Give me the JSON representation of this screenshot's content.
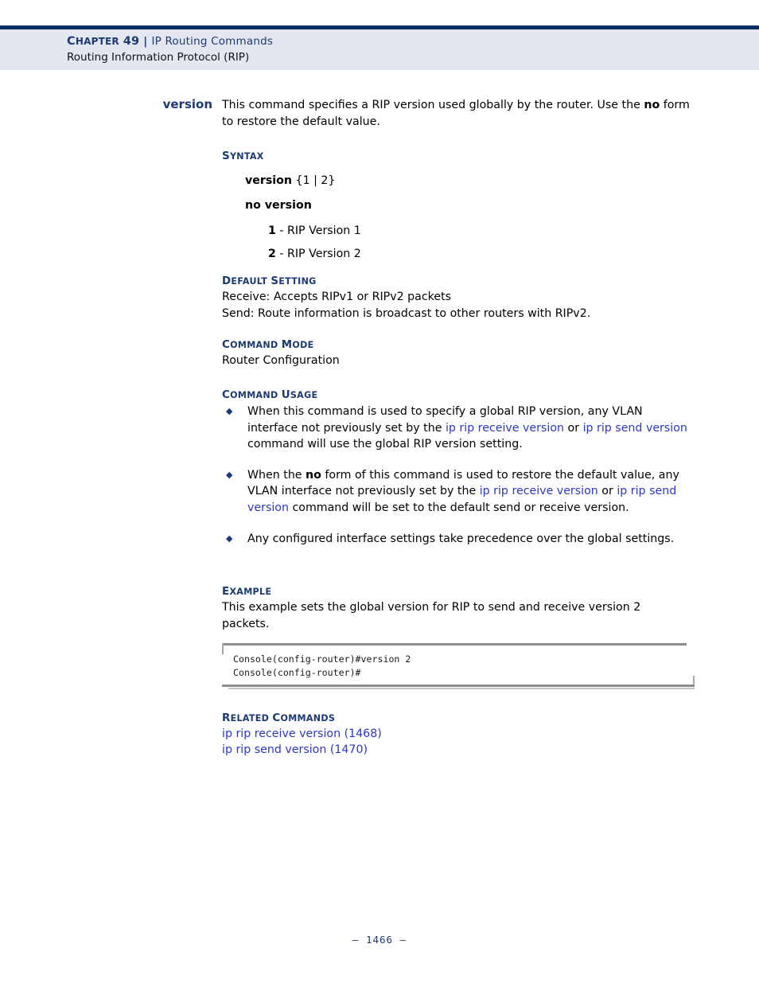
{
  "header": {
    "chapter_label_cap": "C",
    "chapter_label_rest": "HAPTER",
    "chapter_number": "49",
    "separator": "|",
    "topic": "IP Routing Commands",
    "subtitle": "Routing Information Protocol (RIP)"
  },
  "command": {
    "name": "version",
    "intro_part1": "This command specifies a RIP version used globally by the router. Use the ",
    "intro_bold": "no",
    "intro_part2": " form to restore the default value."
  },
  "sections": {
    "syntax": {
      "cap": "S",
      "rest": "YNTAX"
    },
    "default_setting": {
      "cap": "D",
      "rest": "EFAULT ",
      "cap2": "S",
      "rest2": "ETTING"
    },
    "command_mode": {
      "cap": "C",
      "rest": "OMMAND ",
      "cap2": "M",
      "rest2": "ODE"
    },
    "command_usage": {
      "cap": "C",
      "rest": "OMMAND ",
      "cap2": "U",
      "rest2": "SAGE"
    },
    "example": {
      "cap": "E",
      "rest": "XAMPLE"
    },
    "related_commands": {
      "cap": "R",
      "rest": "ELATED ",
      "cap2": "C",
      "rest2": "OMMANDS"
    }
  },
  "syntax": {
    "command_name": "version",
    "braces": " {1 | 2}",
    "brace_open": "{",
    "brace_arg1": "1",
    "brace_pipe": "|",
    "brace_arg2": "2",
    "brace_close": "}",
    "no_form": "no version",
    "args": [
      {
        "key": "1",
        "desc": " - RIP Version 1"
      },
      {
        "key": "2",
        "desc": " - RIP Version 2"
      }
    ]
  },
  "default_setting": {
    "line1": "Receive: Accepts RIPv1 or RIPv2 packets",
    "line2": "Send: Route information is broadcast to other routers with RIPv2."
  },
  "command_mode": {
    "value": "Router Configuration"
  },
  "command_usage": {
    "bullet_glyph": "◆",
    "items": [
      {
        "t1": "When this command is used to specify a global RIP version, any VLAN interface not previously set by the ",
        "link1": "ip rip receive version",
        "t2": " or ",
        "link2": "ip rip send version",
        "t3": " command will use the global RIP version setting."
      },
      {
        "t1": "When the ",
        "bold1": "no",
        "t2": " form of this command is used to restore the default value, any VLAN interface not previously set by the ",
        "link1": "ip rip receive version",
        "t3": " or ",
        "link2": "ip rip send version",
        "t4": " command will be set to the default send or receive version."
      },
      {
        "t1": "Any configured interface settings take precedence over the global settings."
      }
    ]
  },
  "example": {
    "description": "This example sets the global version for RIP to send and receive version 2 packets.",
    "console_lines": "Console(config-router)#version 2\nConsole(config-router)#"
  },
  "related_commands": {
    "links": [
      "ip rip receive version (1468)",
      "ip rip send version (1470)"
    ]
  },
  "footer": {
    "page_number": "–  1466  –"
  }
}
